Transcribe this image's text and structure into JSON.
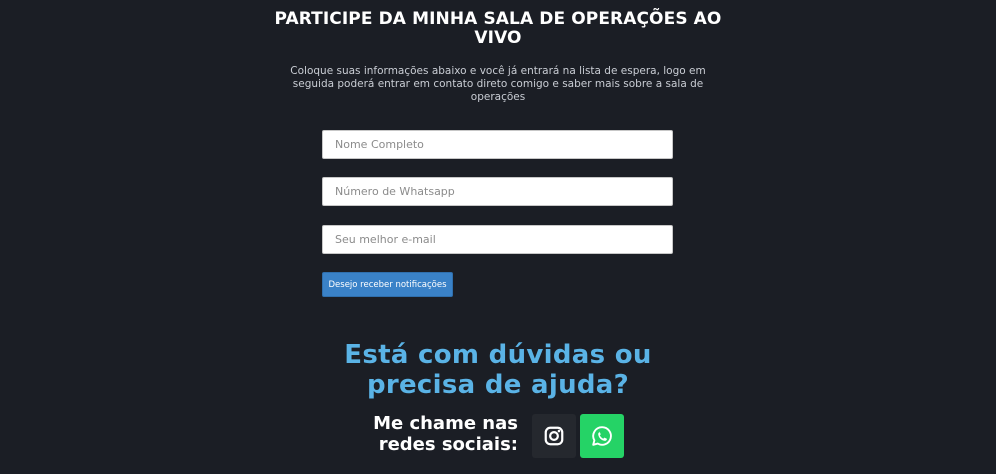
{
  "header": {
    "title": "PARTICIPE DA MINHA SALA DE OPERAÇÕES AO VIVO",
    "subtitle": "Coloque suas informações abaixo e você já entrará na lista de espera, logo em seguida poderá entrar em contato direto comigo e saber mais sobre a sala de operações"
  },
  "form": {
    "name_placeholder": "Nome Completo",
    "phone_placeholder": "Número de Whatsapp",
    "email_placeholder": "Seu melhor e-mail",
    "submit_label": "Desejo receber notificações"
  },
  "help": {
    "heading": "Está com dúvidas ou precisa de ajuda?",
    "social_label": "Me chame nas redes sociais:"
  },
  "social": [
    {
      "icon": "instagram-icon",
      "color": "#25282e"
    },
    {
      "icon": "whatsapp-icon",
      "color": "#25d366"
    }
  ],
  "colors": {
    "background": "#1b1e25",
    "accent_button": "#3a82c8",
    "heading_accent": "#5ab3e6"
  }
}
